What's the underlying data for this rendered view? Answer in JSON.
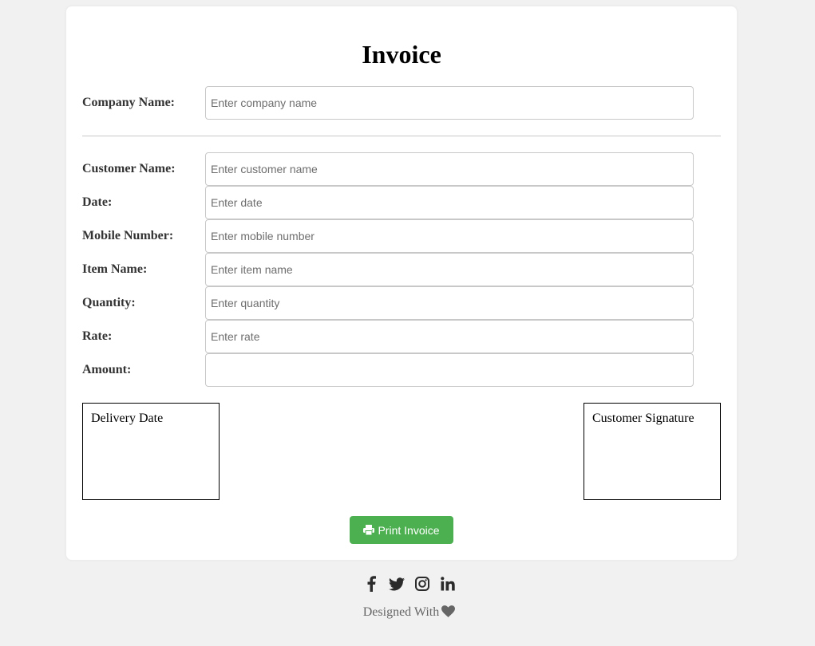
{
  "invoice": {
    "title": "Invoice"
  },
  "company": {
    "label": "Company Name:",
    "placeholder": "Enter company name",
    "value": ""
  },
  "fields": [
    {
      "label": "Customer Name:",
      "placeholder": "Enter customer name",
      "value": ""
    },
    {
      "label": "Date:",
      "placeholder": "Enter date",
      "value": ""
    },
    {
      "label": "Mobile Number:",
      "placeholder": "Enter mobile number",
      "value": ""
    },
    {
      "label": "Item Name:",
      "placeholder": "Enter item name",
      "value": ""
    },
    {
      "label": "Quantity:",
      "placeholder": "Enter quantity",
      "value": ""
    },
    {
      "label": "Rate:",
      "placeholder": "Enter rate",
      "value": ""
    },
    {
      "label": "Amount:",
      "placeholder": "",
      "value": ""
    }
  ],
  "boxes": {
    "delivery": "Delivery Date",
    "signature": "Customer Signature"
  },
  "print_button": {
    "label": "Print Invoice",
    "icon": "print-icon",
    "color": "#4caf50"
  },
  "socials": [
    {
      "icon": "facebook-icon"
    },
    {
      "icon": "twitter-icon"
    },
    {
      "icon": "instagram-icon"
    },
    {
      "icon": "linkedin-icon"
    }
  ],
  "footer": {
    "text": "Designed With",
    "icon": "heart-icon"
  }
}
